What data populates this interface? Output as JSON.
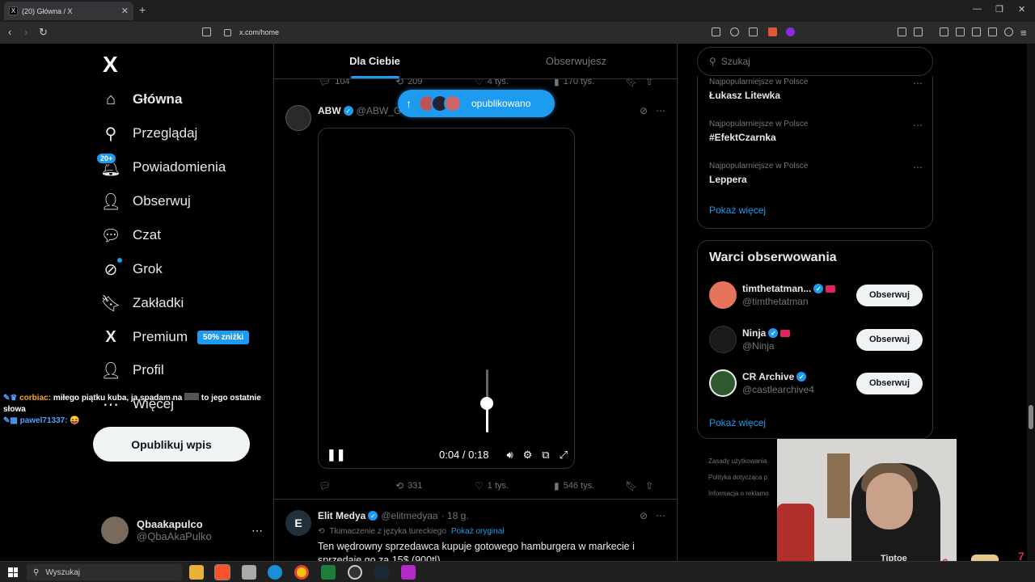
{
  "browser": {
    "tab_title": "(20) Główna / X",
    "tab_favicon": "X",
    "tab_close": "✕",
    "new_tab": "+",
    "url": "x.com/home"
  },
  "sidebar": {
    "logo": "X",
    "items": [
      {
        "label": "Główna",
        "icon": "home-icon",
        "glyph": "⌂"
      },
      {
        "label": "Przeglądaj",
        "icon": "search-icon",
        "glyph": "⚲"
      },
      {
        "label": "Powiadomienia",
        "icon": "bell-icon",
        "glyph": "🔔︎",
        "badge": "20+"
      },
      {
        "label": "Obserwuj",
        "icon": "follow-icon",
        "glyph": "👤︎"
      },
      {
        "label": "Czat",
        "icon": "chat-icon",
        "glyph": "💬︎"
      },
      {
        "label": "Grok",
        "icon": "grok-icon",
        "glyph": "⊘"
      },
      {
        "label": "Zakładki",
        "icon": "bookmark-icon",
        "glyph": "🔖︎"
      },
      {
        "label": "Premium",
        "icon": "x-premium-icon",
        "glyph": "X",
        "pill": "50% zniżki"
      },
      {
        "label": "Profil",
        "icon": "profile-icon",
        "glyph": "👤︎"
      },
      {
        "label": "Więcej",
        "icon": "more-icon",
        "glyph": "⋯"
      }
    ],
    "publish_button": "Opublikuj wpis",
    "account": {
      "name": "Qbaakapulco",
      "handle": "@QbaAkaPulko",
      "more": "⋯"
    }
  },
  "chat_overlay": {
    "line1_user": "corbiac:",
    "line1_text": "miłego piątku kuba, ja spadam na",
    "line1_tail": "to jego ostatnie słowa",
    "line2_user": "pawel71337:",
    "line2_text": "😝"
  },
  "feed": {
    "tabs": [
      "Dla Ciebie",
      "Obserwujesz"
    ],
    "prev_post_stats": {
      "replies": "104",
      "reposts": "209",
      "likes": "4 tys.",
      "views": "170 tys."
    },
    "new_posts_label": "opublikowano",
    "post1": {
      "name": "ABW",
      "handle": "@ABW_GO",
      "video": {
        "time": "0:04 / 0:18",
        "volume": 0.45
      },
      "stats": {
        "replies": "",
        "reposts": "331",
        "likes": "1 tys.",
        "views": "546 tys."
      }
    },
    "post2": {
      "name": "Elit Medya",
      "avatar_letter": "E",
      "handle": "@elitmedyaa",
      "time": "· 18 g.",
      "translation_note": "Tłumaczenie z języka tureckiego",
      "translation_link": "Pokaż oryginał",
      "text_line1": "Ten wędrowny sprzedawca kupuje gotowego hamburgera w markecie i",
      "text_line2": "sprzedaje go za 15$ (900tl)"
    }
  },
  "right": {
    "search_placeholder": "Szukaj",
    "trends": [
      {
        "category": "Najpopularniejsze w Polsce",
        "name": "Łukasz Litewka"
      },
      {
        "category": "Najpopularniejsze w Polsce",
        "name": "#EfektCzarnka"
      },
      {
        "category": "Najpopularniejsze w Polsce",
        "name": "Leppera"
      }
    ],
    "trends_show_more": "Pokaż więcej",
    "who_to_follow": {
      "title": "Warci obserwowania",
      "accounts": [
        {
          "name": "timthetatman...",
          "handle": "@timthetatman",
          "button": "Obserwuj",
          "avatar_color": "#e6735c"
        },
        {
          "name": "Ninja",
          "handle": "@Ninja",
          "button": "Obserwuj",
          "avatar_color": "#1a1a1a"
        },
        {
          "name": "CR Archive",
          "handle": "@castlearchive4",
          "button": "Obserwuj",
          "avatar_color": "#2f5a2f"
        }
      ],
      "show_more": "Pokaż więcej"
    },
    "footer": [
      "Zasady użytkowania",
      "Polityka dotycząca p",
      "Informacja o reklamo"
    ]
  },
  "webcam": {
    "shirt_text": "Tiptoe"
  },
  "taskbar": {
    "search": "Wyszukaj"
  },
  "colors": {
    "accent": "#1d9bf0",
    "background": "#000000",
    "border": "#2f3336"
  }
}
